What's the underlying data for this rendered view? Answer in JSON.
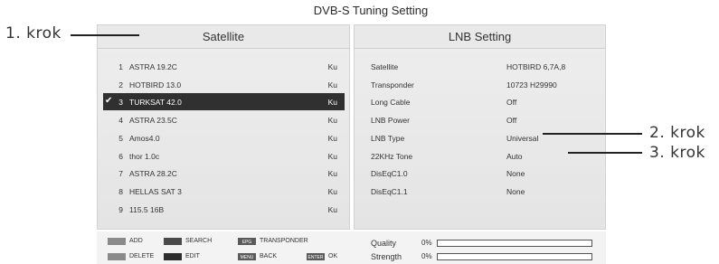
{
  "title": "DVB-S Tuning Setting",
  "satellite_panel": {
    "heading": "Satellite",
    "items": [
      {
        "num": "1",
        "name": "ASTRA 19.2C",
        "band": "Ku",
        "selected": false
      },
      {
        "num": "2",
        "name": "HOTBIRD 13.0",
        "band": "Ku",
        "selected": false
      },
      {
        "num": "3",
        "name": "TURKSAT 42.0",
        "band": "Ku",
        "selected": true
      },
      {
        "num": "4",
        "name": "ASTRA 23.5C",
        "band": "Ku",
        "selected": false
      },
      {
        "num": "5",
        "name": "Amos4.0",
        "band": "Ku",
        "selected": false
      },
      {
        "num": "6",
        "name": "thor 1.0c",
        "band": "Ku",
        "selected": false
      },
      {
        "num": "7",
        "name": "ASTRA 28.2C",
        "band": "Ku",
        "selected": false
      },
      {
        "num": "8",
        "name": "HELLAS SAT 3",
        "band": "Ku",
        "selected": false
      },
      {
        "num": "9",
        "name": "115.5 16B",
        "band": "Ku",
        "selected": false
      }
    ]
  },
  "lnb_panel": {
    "heading": "LNB Setting",
    "rows": [
      {
        "label": "Satellite",
        "value": "HOTBIRD 6,7A,8"
      },
      {
        "label": "Transponder",
        "value": "10723 H29990"
      },
      {
        "label": "Long  Cable",
        "value": "Off"
      },
      {
        "label": "LNB Power",
        "value": "Off"
      },
      {
        "label": "LNB Type",
        "value": "Universal"
      },
      {
        "label": "22KHz Tone",
        "value": "Auto"
      },
      {
        "label": "DisEqC1.0",
        "value": "None"
      },
      {
        "label": "DisEqC1.1",
        "value": "None"
      }
    ]
  },
  "footer": {
    "add": "ADD",
    "search": "SEARCH",
    "epg_key": "EPG",
    "transponder": "TRANSPONDER",
    "delete": "DELETE",
    "edit": "EDIT",
    "menu_key": "MENU",
    "back": "BACK",
    "enter_key": "ENTER",
    "ok": "OK"
  },
  "meters": {
    "quality_label": "Quality",
    "quality_pct": "0%",
    "quality_value": 0.0,
    "strength_label": "Strength",
    "strength_pct": "0%",
    "strength_value": 0.0
  },
  "colors": {
    "add_chip": "#8a8a8a",
    "search_chip": "#4a4a4a",
    "delete_chip": "#8a8a8a",
    "edit_chip": "#2e2e2e",
    "key_chip": "#5a5a5a",
    "selected_row": "#303030"
  },
  "callouts": {
    "step1": "1. krok",
    "step2": "2. krok",
    "step3": "3. krok"
  }
}
